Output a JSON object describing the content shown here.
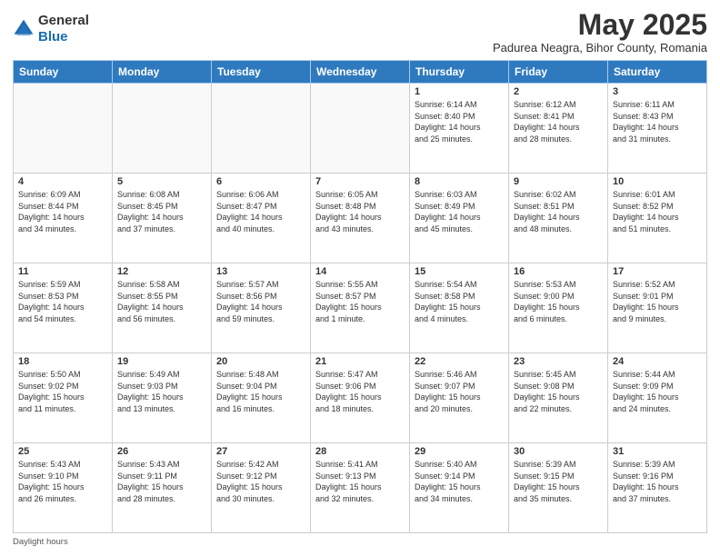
{
  "logo": {
    "general": "General",
    "blue": "Blue"
  },
  "header": {
    "month": "May 2025",
    "location": "Padurea Neagra, Bihor County, Romania"
  },
  "days_of_week": [
    "Sunday",
    "Monday",
    "Tuesday",
    "Wednesday",
    "Thursday",
    "Friday",
    "Saturday"
  ],
  "footer": {
    "label": "Daylight hours"
  },
  "weeks": [
    [
      {
        "day": "",
        "info": ""
      },
      {
        "day": "",
        "info": ""
      },
      {
        "day": "",
        "info": ""
      },
      {
        "day": "",
        "info": ""
      },
      {
        "day": "1",
        "info": "Sunrise: 6:14 AM\nSunset: 8:40 PM\nDaylight: 14 hours\nand 25 minutes."
      },
      {
        "day": "2",
        "info": "Sunrise: 6:12 AM\nSunset: 8:41 PM\nDaylight: 14 hours\nand 28 minutes."
      },
      {
        "day": "3",
        "info": "Sunrise: 6:11 AM\nSunset: 8:43 PM\nDaylight: 14 hours\nand 31 minutes."
      }
    ],
    [
      {
        "day": "4",
        "info": "Sunrise: 6:09 AM\nSunset: 8:44 PM\nDaylight: 14 hours\nand 34 minutes."
      },
      {
        "day": "5",
        "info": "Sunrise: 6:08 AM\nSunset: 8:45 PM\nDaylight: 14 hours\nand 37 minutes."
      },
      {
        "day": "6",
        "info": "Sunrise: 6:06 AM\nSunset: 8:47 PM\nDaylight: 14 hours\nand 40 minutes."
      },
      {
        "day": "7",
        "info": "Sunrise: 6:05 AM\nSunset: 8:48 PM\nDaylight: 14 hours\nand 43 minutes."
      },
      {
        "day": "8",
        "info": "Sunrise: 6:03 AM\nSunset: 8:49 PM\nDaylight: 14 hours\nand 45 minutes."
      },
      {
        "day": "9",
        "info": "Sunrise: 6:02 AM\nSunset: 8:51 PM\nDaylight: 14 hours\nand 48 minutes."
      },
      {
        "day": "10",
        "info": "Sunrise: 6:01 AM\nSunset: 8:52 PM\nDaylight: 14 hours\nand 51 minutes."
      }
    ],
    [
      {
        "day": "11",
        "info": "Sunrise: 5:59 AM\nSunset: 8:53 PM\nDaylight: 14 hours\nand 54 minutes."
      },
      {
        "day": "12",
        "info": "Sunrise: 5:58 AM\nSunset: 8:55 PM\nDaylight: 14 hours\nand 56 minutes."
      },
      {
        "day": "13",
        "info": "Sunrise: 5:57 AM\nSunset: 8:56 PM\nDaylight: 14 hours\nand 59 minutes."
      },
      {
        "day": "14",
        "info": "Sunrise: 5:55 AM\nSunset: 8:57 PM\nDaylight: 15 hours\nand 1 minute."
      },
      {
        "day": "15",
        "info": "Sunrise: 5:54 AM\nSunset: 8:58 PM\nDaylight: 15 hours\nand 4 minutes."
      },
      {
        "day": "16",
        "info": "Sunrise: 5:53 AM\nSunset: 9:00 PM\nDaylight: 15 hours\nand 6 minutes."
      },
      {
        "day": "17",
        "info": "Sunrise: 5:52 AM\nSunset: 9:01 PM\nDaylight: 15 hours\nand 9 minutes."
      }
    ],
    [
      {
        "day": "18",
        "info": "Sunrise: 5:50 AM\nSunset: 9:02 PM\nDaylight: 15 hours\nand 11 minutes."
      },
      {
        "day": "19",
        "info": "Sunrise: 5:49 AM\nSunset: 9:03 PM\nDaylight: 15 hours\nand 13 minutes."
      },
      {
        "day": "20",
        "info": "Sunrise: 5:48 AM\nSunset: 9:04 PM\nDaylight: 15 hours\nand 16 minutes."
      },
      {
        "day": "21",
        "info": "Sunrise: 5:47 AM\nSunset: 9:06 PM\nDaylight: 15 hours\nand 18 minutes."
      },
      {
        "day": "22",
        "info": "Sunrise: 5:46 AM\nSunset: 9:07 PM\nDaylight: 15 hours\nand 20 minutes."
      },
      {
        "day": "23",
        "info": "Sunrise: 5:45 AM\nSunset: 9:08 PM\nDaylight: 15 hours\nand 22 minutes."
      },
      {
        "day": "24",
        "info": "Sunrise: 5:44 AM\nSunset: 9:09 PM\nDaylight: 15 hours\nand 24 minutes."
      }
    ],
    [
      {
        "day": "25",
        "info": "Sunrise: 5:43 AM\nSunset: 9:10 PM\nDaylight: 15 hours\nand 26 minutes."
      },
      {
        "day": "26",
        "info": "Sunrise: 5:43 AM\nSunset: 9:11 PM\nDaylight: 15 hours\nand 28 minutes."
      },
      {
        "day": "27",
        "info": "Sunrise: 5:42 AM\nSunset: 9:12 PM\nDaylight: 15 hours\nand 30 minutes."
      },
      {
        "day": "28",
        "info": "Sunrise: 5:41 AM\nSunset: 9:13 PM\nDaylight: 15 hours\nand 32 minutes."
      },
      {
        "day": "29",
        "info": "Sunrise: 5:40 AM\nSunset: 9:14 PM\nDaylight: 15 hours\nand 34 minutes."
      },
      {
        "day": "30",
        "info": "Sunrise: 5:39 AM\nSunset: 9:15 PM\nDaylight: 15 hours\nand 35 minutes."
      },
      {
        "day": "31",
        "info": "Sunrise: 5:39 AM\nSunset: 9:16 PM\nDaylight: 15 hours\nand 37 minutes."
      }
    ]
  ]
}
